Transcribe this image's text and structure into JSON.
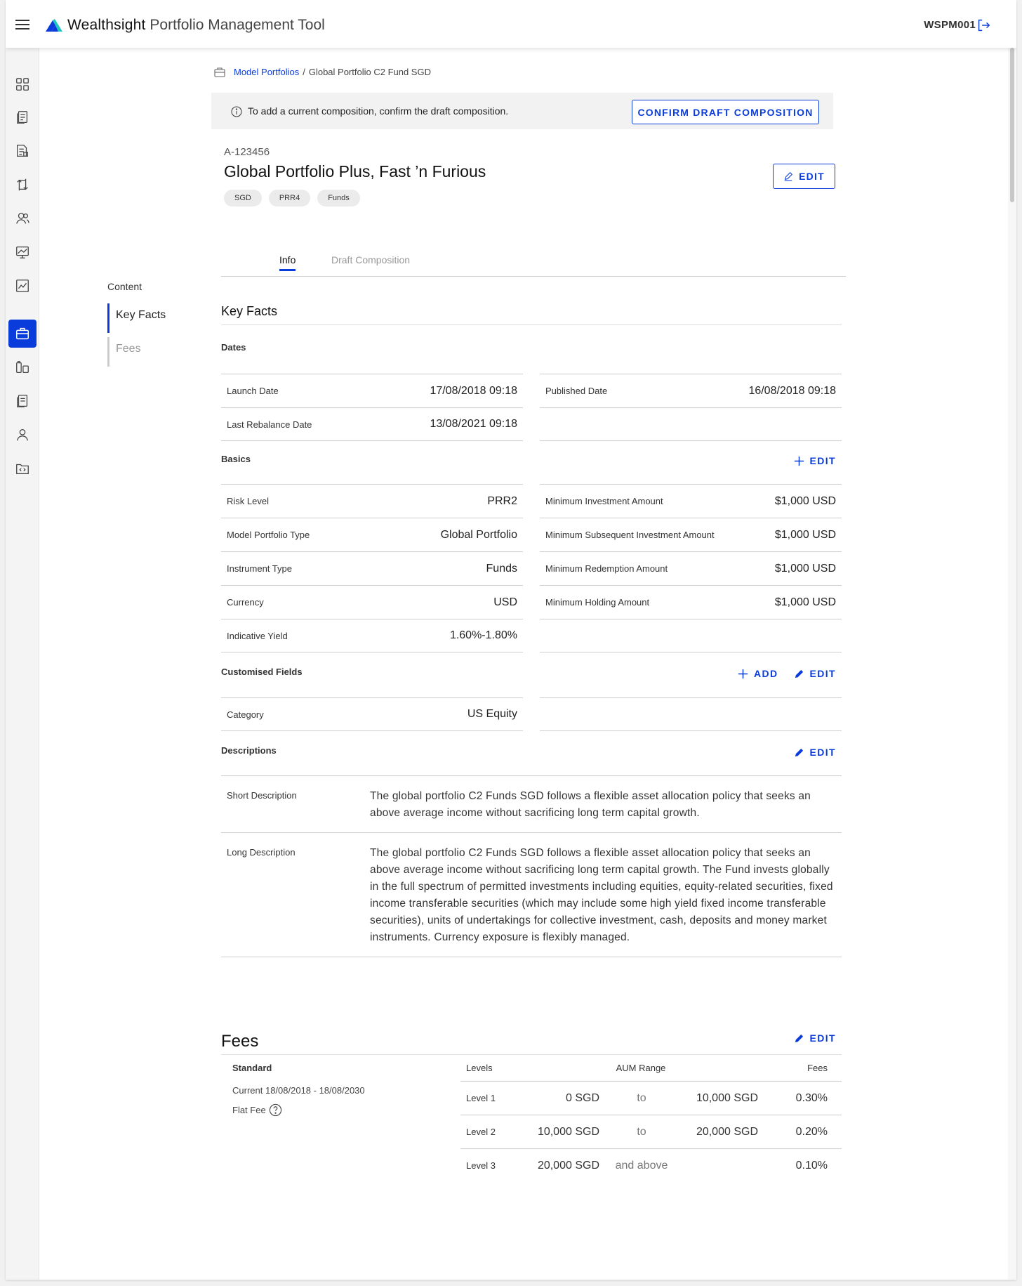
{
  "header": {
    "brand": "Wealthsight",
    "subtitle": "Portfolio Management Tool",
    "user_id": "WSPM001"
  },
  "sidebar": {
    "icons": [
      "dashboard-icon",
      "document-list-icon",
      "report-icon",
      "transfer-icon",
      "users-icon",
      "presentation-icon",
      "chart-icon",
      "briefcase-icon",
      "compare-icon",
      "document-icon",
      "person-icon",
      "code-folder-icon"
    ],
    "active_color": "#0a3cdb"
  },
  "toc": {
    "heading": "Content",
    "items": [
      {
        "label": "Key Facts",
        "active": true
      },
      {
        "label": "Fees",
        "active": false
      }
    ]
  },
  "breadcrumb": {
    "parent": "Model Portfolios",
    "separator": "/",
    "current": "Global Portfolio C2 Fund SGD"
  },
  "banner": {
    "message": "To add a current composition, confirm the draft composition.",
    "button": "CONFIRM DRAFT COMPOSITION"
  },
  "portfolio": {
    "ref": "A-123456",
    "title": "Global Portfolio Plus, Fast ’n Furious",
    "chips": [
      "SGD",
      "PRR4",
      "Funds"
    ],
    "edit_label": "EDIT"
  },
  "tabs": [
    {
      "label": "Info",
      "active": true
    },
    {
      "label": "Draft Composition",
      "active": false
    }
  ],
  "key_facts": {
    "heading": "Key Facts",
    "dates": {
      "heading": "Dates",
      "left": [
        {
          "label": "Launch Date",
          "value": "17/08/2018 09:18"
        },
        {
          "label": "Last Rebalance Date",
          "value": "13/08/2021 09:18"
        }
      ],
      "right": [
        {
          "label": "Published Date",
          "value": "16/08/2018 09:18"
        }
      ]
    },
    "basics": {
      "heading": "Basics",
      "edit_label": "EDIT",
      "left": [
        {
          "label": "Risk Level",
          "value": "PRR2"
        },
        {
          "label": "Model Portfolio Type",
          "value": "Global Portfolio"
        },
        {
          "label": "Instrument Type",
          "value": "Funds"
        },
        {
          "label": "Currency",
          "value": "USD"
        },
        {
          "label": "Indicative Yield",
          "value": "1.60%-1.80%"
        }
      ],
      "right": [
        {
          "label": "Minimum Investment Amount",
          "value": "$1,000 USD"
        },
        {
          "label": "Minimum Subsequent Investment Amount",
          "value": "$1,000 USD"
        },
        {
          "label": "Minimum Redemption Amount",
          "value": "$1,000 USD"
        },
        {
          "label": "Minimum Holding Amount",
          "value": "$1,000 USD"
        }
      ]
    },
    "custom": {
      "heading": "Customised Fields",
      "add_label": "ADD",
      "edit_label": "EDIT",
      "left": [
        {
          "label": "Category",
          "value": "US Equity"
        }
      ]
    },
    "descriptions": {
      "heading": "Descriptions",
      "edit_label": "EDIT",
      "short_label": "Short Description",
      "short_text": "The global portfolio C2 Funds SGD follows a flexible asset allocation policy that seeks an above average income without sacrificing long term capital growth.",
      "long_label": "Long Description",
      "long_text": "The global portfolio C2 Funds SGD follows a flexible asset allocation policy that seeks an above average income without sacrificing long term capital growth. The Fund invests globally in the full spectrum of permitted investments including equities, equity-related securities, fixed income transferable securities (which may include some high yield fixed income transferable securities), units of undertakings for collective investment, cash, deposits and money market instruments. Currency exposure is flexibly managed."
    }
  },
  "fees": {
    "heading": "Fees",
    "edit_label": "EDIT",
    "plan": "Standard",
    "period": "Current 18/08/2018 - 18/08/2030",
    "type": "Flat Fee",
    "columns": {
      "levels": "Levels",
      "range": "AUM Range",
      "fees": "Fees"
    },
    "rows": [
      {
        "level": "Level 1",
        "from": "0 SGD",
        "to": "to",
        "upto": "10,000 SGD",
        "fee": "0.30%"
      },
      {
        "level": "Level 2",
        "from": "10,000 SGD",
        "to": "to",
        "upto": "20,000 SGD",
        "fee": "0.20%"
      },
      {
        "level": "Level 3",
        "from": "20,000 SGD",
        "to": "and above",
        "upto": "",
        "fee": "0.10%"
      }
    ]
  }
}
